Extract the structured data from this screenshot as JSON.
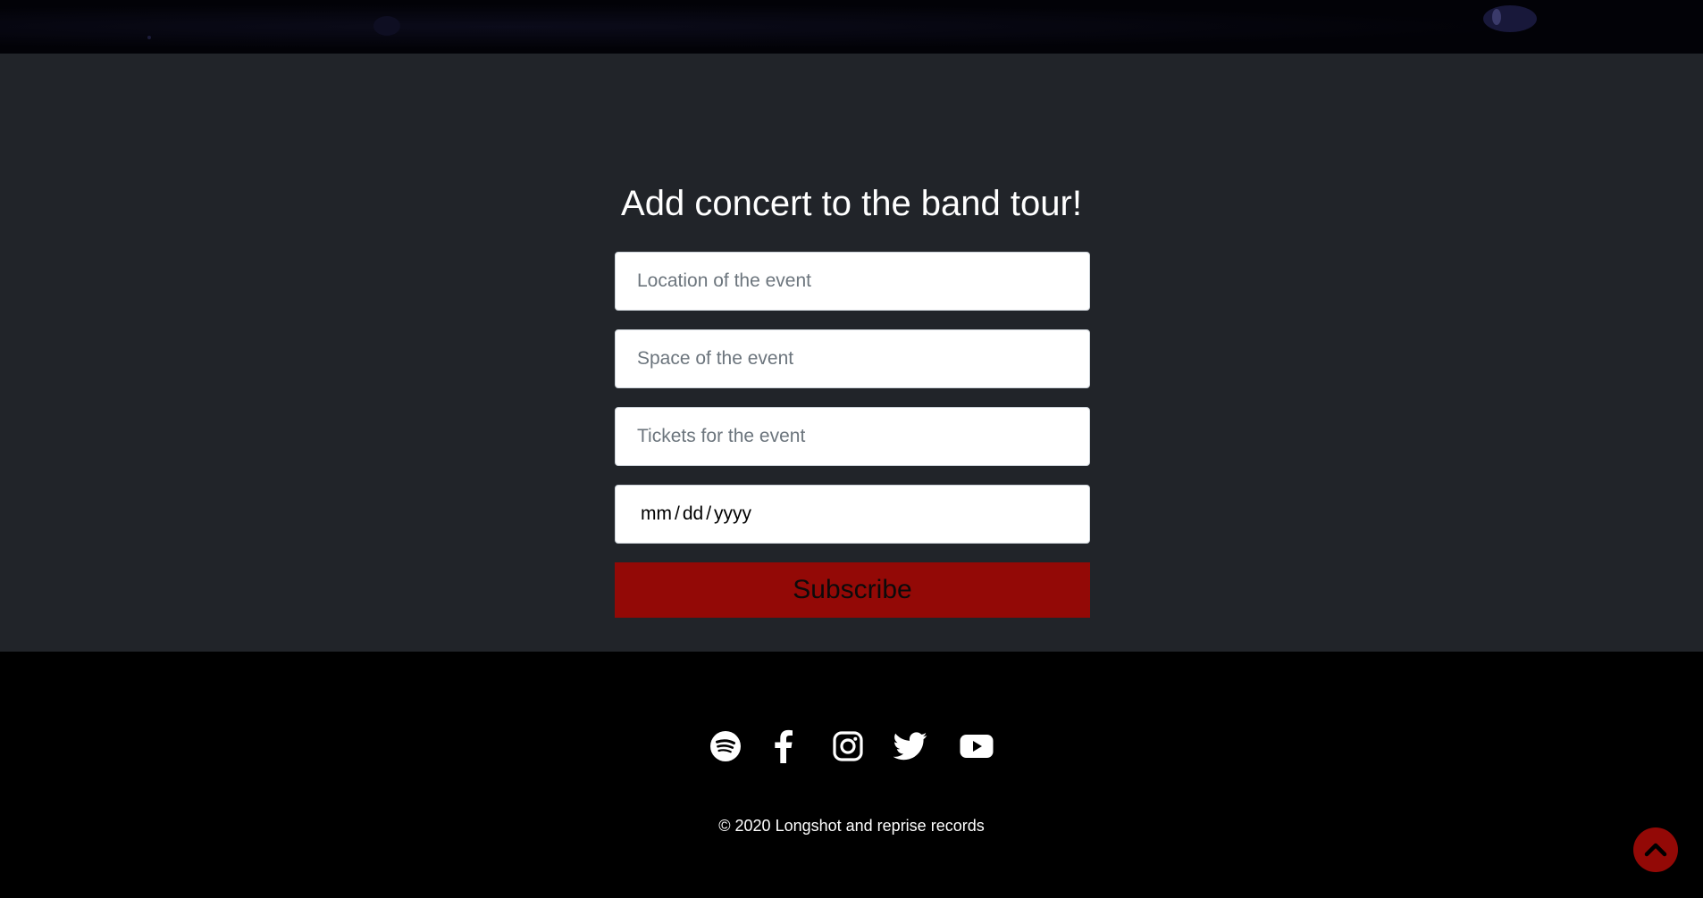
{
  "form": {
    "heading": "Add concert to the band tour!",
    "location_placeholder": "Location of the event",
    "space_placeholder": "Space of the event",
    "tickets_placeholder": "Tickets for the event",
    "date_parts": [
      "mm",
      "dd",
      "yyyy"
    ],
    "date_separator": "/",
    "submit_label": "Subscribe"
  },
  "footer": {
    "social_icons": [
      "spotify-icon",
      "facebook-icon",
      "instagram-icon",
      "twitter-icon",
      "youtube-icon"
    ],
    "copyright": "© 2020 Longshot and reprise records"
  },
  "scroll_top": {
    "icon": "chevron-up-icon"
  },
  "colors": {
    "accent": "#930906",
    "section_bg": "#212429",
    "footer_bg": "#000000",
    "text_light": "#ffffff"
  }
}
